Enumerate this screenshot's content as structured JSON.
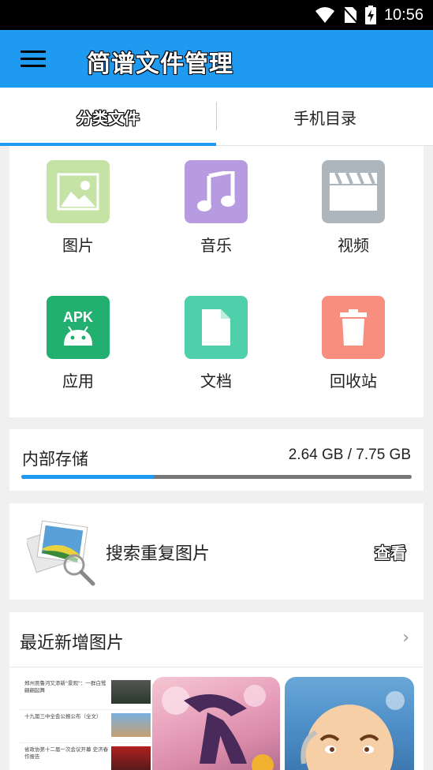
{
  "status": {
    "time": "10:56"
  },
  "appbar": {
    "title": "简谱文件管理"
  },
  "tabs": [
    {
      "label": "分类文件"
    },
    {
      "label": "手机目录"
    }
  ],
  "categories": [
    {
      "label": "图片",
      "icon": "image-icon",
      "color": "#c5e3a4"
    },
    {
      "label": "音乐",
      "icon": "music-icon",
      "color": "#b69be0"
    },
    {
      "label": "视频",
      "icon": "video-icon",
      "color": "#aeb6bd"
    },
    {
      "label": "应用",
      "icon": "android-apk-icon",
      "color": "#22b070",
      "badge": "APK"
    },
    {
      "label": "文档",
      "icon": "document-icon",
      "color": "#4fd0aa"
    },
    {
      "label": "回收站",
      "icon": "trash-icon",
      "color": "#f88e7e"
    }
  ],
  "storage": {
    "label": "内部存储",
    "used": "2.64 GB",
    "separator": "/",
    "total": "7.75 GB",
    "used_fraction": 0.34
  },
  "duplicates": {
    "label": "搜索重复图片",
    "action": "查看"
  },
  "recent": {
    "title": "最近新增图片",
    "news": [
      "郑州贾鲁河又添新\"景观\"：一群白鹭翩翩起舞",
      "十九届三中全会公报公布（全文）",
      "省政协第十二届一次会议开幕 史济春作报告"
    ]
  },
  "colors": {
    "primary": "#1e9af0",
    "storage_track": "#777777"
  }
}
